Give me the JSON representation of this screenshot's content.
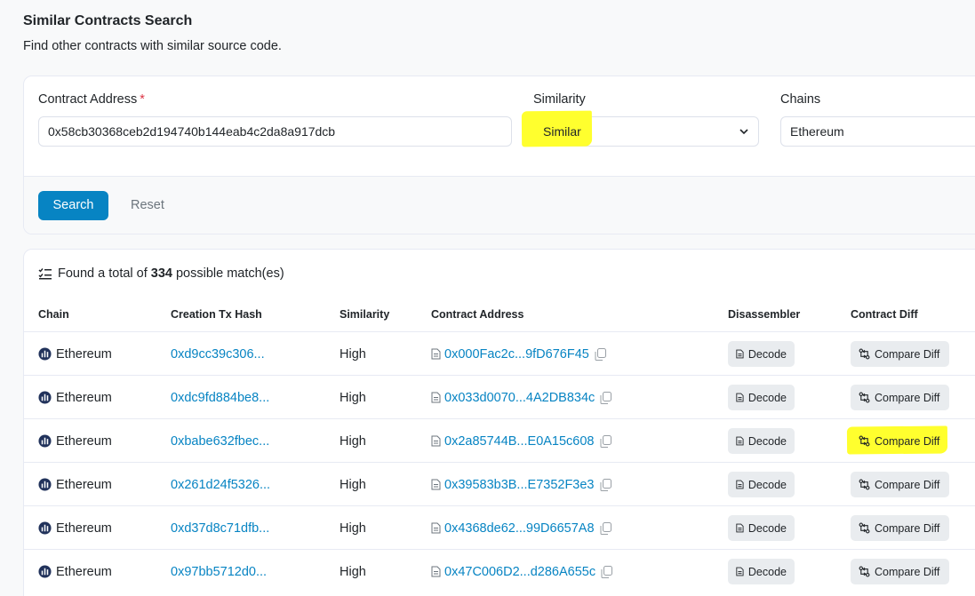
{
  "header": {
    "title": "Similar Contracts Search",
    "subtitle": "Find other contracts with similar source code."
  },
  "form": {
    "contract_address_label": "Contract Address",
    "required_mark": "*",
    "contract_address_value": "0x58cb30368ceb2d194740b144eab4c2da8a917dcb",
    "similarity_label": "Similarity",
    "similarity_value": "Similar",
    "chains_label": "Chains",
    "chains_value": "Ethereum",
    "search_label": "Search",
    "reset_label": "Reset"
  },
  "results": {
    "summary_prefix": "Found a total of",
    "count": "334",
    "summary_suffix": "possible match(es)",
    "columns": [
      "Chain",
      "Creation Tx Hash",
      "Similarity",
      "Contract Address",
      "Disassembler",
      "Contract Diff"
    ],
    "rows": [
      {
        "chain": "Ethereum",
        "tx_hash": "0xd9cc39c306...",
        "similarity": "High",
        "address": "0x000Fac2c...9fD676F45",
        "decode": "Decode",
        "diff": "Compare Diff",
        "highlighted": false
      },
      {
        "chain": "Ethereum",
        "tx_hash": "0xdc9fd884be8...",
        "similarity": "High",
        "address": "0x033d0070...4A2DB834c",
        "decode": "Decode",
        "diff": "Compare Diff",
        "highlighted": false
      },
      {
        "chain": "Ethereum",
        "tx_hash": "0xbabe632fbec...",
        "similarity": "High",
        "address": "0x2a85744B...E0A15c608",
        "decode": "Decode",
        "diff": "Compare Diff",
        "highlighted": true
      },
      {
        "chain": "Ethereum",
        "tx_hash": "0x261d24f5326...",
        "similarity": "High",
        "address": "0x39583b3B...E7352F3e3",
        "decode": "Decode",
        "diff": "Compare Diff",
        "highlighted": false
      },
      {
        "chain": "Ethereum",
        "tx_hash": "0xd37d8c71dfb...",
        "similarity": "High",
        "address": "0x4368de62...99D6657A8",
        "decode": "Decode",
        "diff": "Compare Diff",
        "highlighted": false
      },
      {
        "chain": "Ethereum",
        "tx_hash": "0x97bb5712d0...",
        "similarity": "High",
        "address": "0x47C006D2...d286A655c",
        "decode": "Decode",
        "diff": "Compare Diff",
        "highlighted": false
      }
    ]
  },
  "icons": {
    "chain": "ethereum-logo-icon",
    "address": "document-icon",
    "copy": "copy-icon",
    "decode": "file-code-icon",
    "diff": "arrows-exchange-icon",
    "summary": "list-check-icon",
    "select": "chevron-down-icon"
  },
  "colors": {
    "link": "#0784c3",
    "primary_button": "#0784c3",
    "highlight": "#ffff2e",
    "required": "#dc3545"
  }
}
